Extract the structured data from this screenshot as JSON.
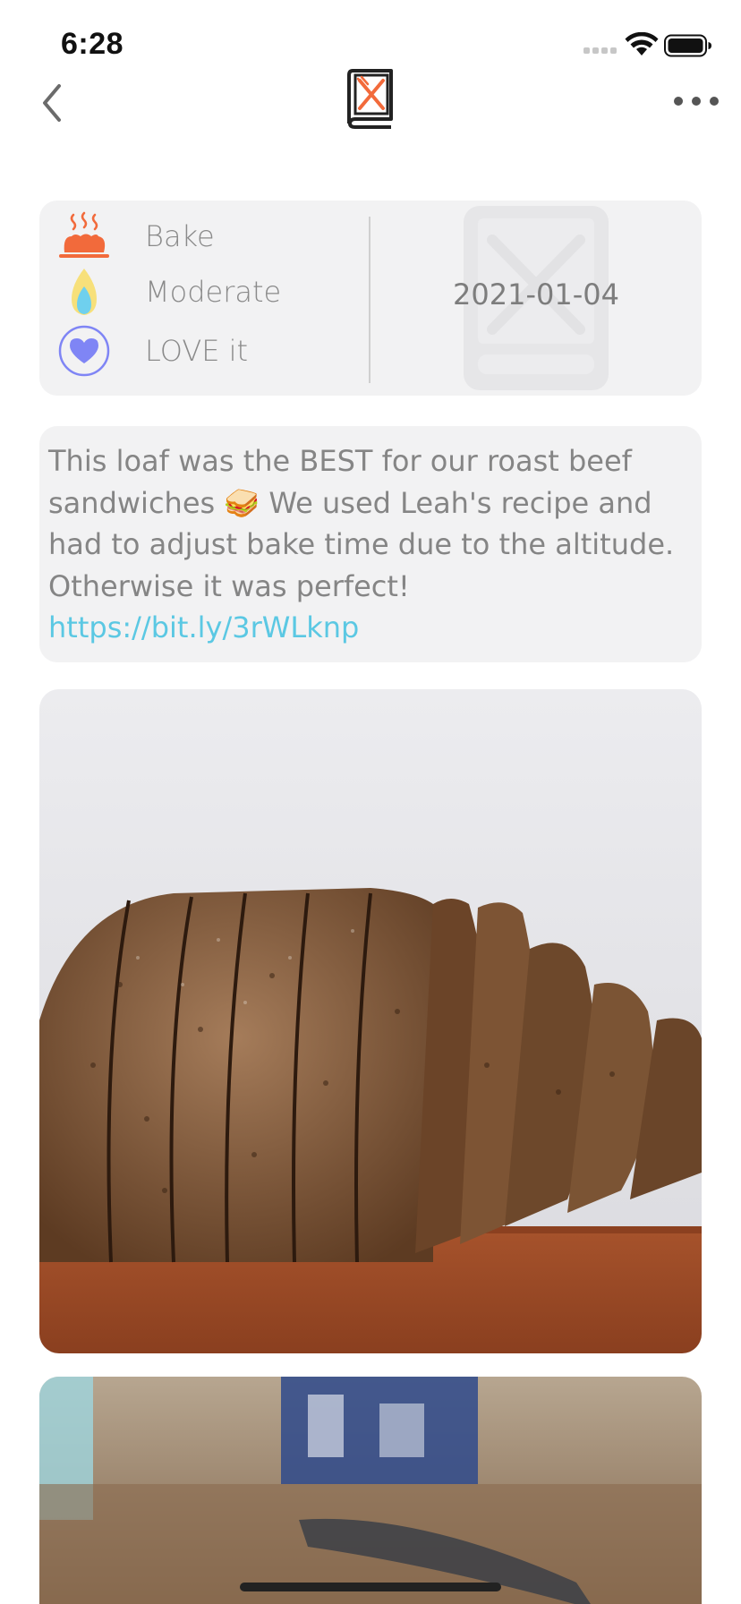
{
  "status_bar": {
    "time": "6:28"
  },
  "nav": {
    "back_icon": "chevron-left-icon",
    "logo_icon": "cookbook-logo-icon",
    "more_icon": "more-icon"
  },
  "summary": {
    "method": {
      "label": "Bake",
      "icon": "bake-icon"
    },
    "difficulty": {
      "label": "Moderate",
      "icon": "flame-icon"
    },
    "rating": {
      "label": "LOVE it",
      "icon": "heart-icon"
    },
    "date": "2021-01-04"
  },
  "notes": {
    "text": "This loaf was the BEST for our roast beef sandwiches 🥪 We used Leah's recipe and had to adjust bake time due to the altitude. Otherwise it was perfect! ",
    "link": "https://bit.ly/3rWLknp"
  },
  "colors": {
    "accent_orange": "#f26a3b",
    "link_blue": "#5bc8e3",
    "heart_purple": "#7f85f5",
    "card_bg": "#f2f2f3"
  }
}
